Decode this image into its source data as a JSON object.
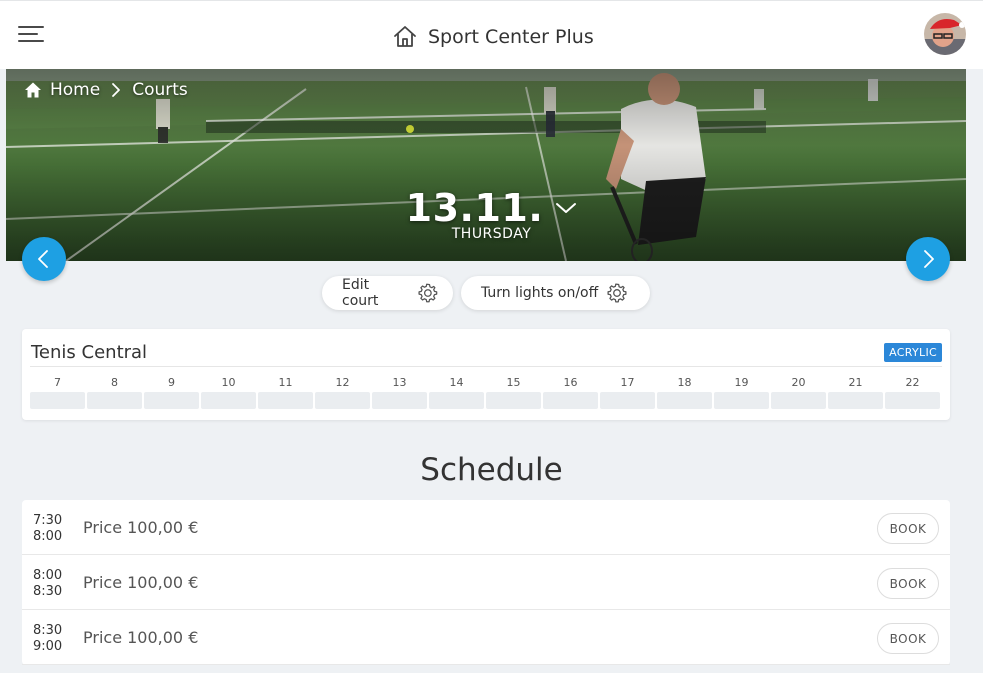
{
  "header": {
    "title": "Sport Center Plus",
    "menu_icon": "hamburger-menu-icon",
    "home_icon": "house-icon",
    "accent_color": "#21a7e6"
  },
  "breadcrumb": {
    "home_label": "Home",
    "current_label": "Courts"
  },
  "date_picker": {
    "date": "13.11.",
    "weekday": "THURSDAY"
  },
  "actions": {
    "edit_court_label": "Edit court",
    "lights_label": "Turn lights on/off"
  },
  "court": {
    "name": "Tenis Central",
    "surface": "ACRYLIC",
    "hours": [
      "7",
      "8",
      "9",
      "10",
      "11",
      "12",
      "13",
      "14",
      "15",
      "16",
      "17",
      "18",
      "19",
      "20",
      "21",
      "22"
    ]
  },
  "schedule": {
    "title": "Schedule",
    "book_label": "BOOK",
    "slots": [
      {
        "start": "7:30",
        "end": "8:00",
        "price": "Price 100,00 €"
      },
      {
        "start": "8:00",
        "end": "8:30",
        "price": "Price 100,00 €"
      },
      {
        "start": "8:30",
        "end": "9:00",
        "price": "Price 100,00 €"
      }
    ]
  },
  "colors": {
    "arrow_button": "#1ea0e3",
    "surface_tag": "#2b87d8",
    "page_bg": "#eef1f4"
  }
}
